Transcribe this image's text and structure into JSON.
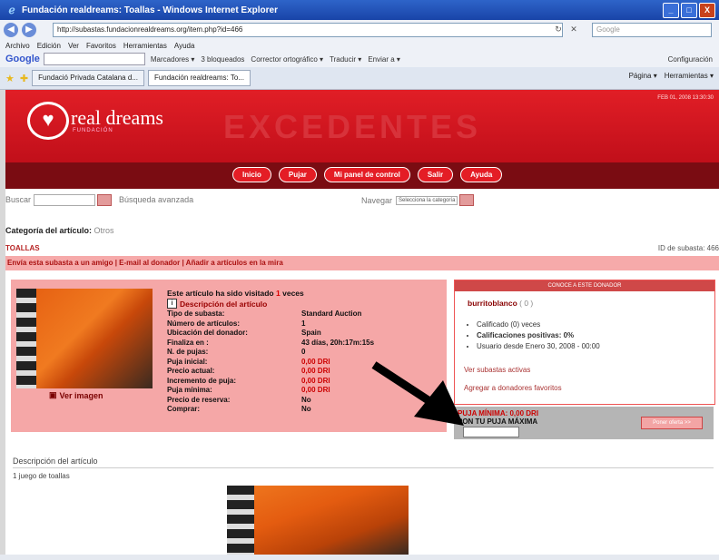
{
  "window": {
    "title": "Fundación realdreams: Toallas - Windows Internet Explorer",
    "minimize": "_",
    "maximize": "□",
    "close": "X"
  },
  "address": {
    "url": "http://subastas.fundacionrealdreams.org/item.php?id=466",
    "search_placeholder": "Google"
  },
  "menu": [
    "Archivo",
    "Edición",
    "Ver",
    "Favoritos",
    "Herramientas",
    "Ayuda"
  ],
  "google_toolbar": {
    "logo": "Google",
    "items": [
      "Marcadores ▾",
      "3 bloqueados",
      "Corrector ortográfico ▾",
      "Traducir ▾",
      "Enviar a ▾"
    ],
    "config": "Configuración"
  },
  "tabs": [
    {
      "label": "Fundació Privada Catalana d..."
    },
    {
      "label": "Fundación realdreams: To..."
    }
  ],
  "tab_tools": [
    "Página ▾",
    "Herramientas ▾"
  ],
  "site": {
    "logo": "real dreams",
    "logo_sub": "FUNDACIÓN",
    "banner": "EXCEDENTES",
    "date": "FEB 01, 2008 13:30:30",
    "nav": [
      "Inicio",
      "Pujar",
      "Mi panel de control",
      "Salir",
      "Ayuda"
    ]
  },
  "search": {
    "label": "Buscar",
    "advanced": "Búsqueda avanzada",
    "browse_label": "Navegar",
    "browse_value": "Selecciona la categoría"
  },
  "category": {
    "label": "Categoría del artículo:",
    "value": "Otros"
  },
  "item": {
    "title": "TOALLAS",
    "auction_id": "ID de subasta: 466",
    "actions": "Envía esta subasta a un amigo | E-mail al donador | Añadir a artículos en la mira",
    "visited_pre": "Este artículo ha sido visitado",
    "visited_count": "1",
    "visited_post": "veces",
    "desc_link": "Descripción del artículo",
    "view_image": "Ver imagen",
    "details": [
      {
        "k": "Tipo de subasta:",
        "v": "Standard Auction",
        "red": false
      },
      {
        "k": "Número de artículos:",
        "v": "1",
        "red": false
      },
      {
        "k": "Ubicación del donador:",
        "v": "Spain",
        "red": false
      },
      {
        "k": "Finaliza en :",
        "v": "43 días, 20h:17m:15s",
        "red": false
      },
      {
        "k": "N. de pujas:",
        "v": "0",
        "red": false
      },
      {
        "k": "Puja inicial:",
        "v": "0,00 DRI",
        "red": true
      },
      {
        "k": "Precio actual:",
        "v": "0,00 DRI",
        "red": true
      },
      {
        "k": "Incremento de puja:",
        "v": "0,00 DRI",
        "red": true
      },
      {
        "k": "Puja mínima:",
        "v": "0,00 DRI",
        "red": true
      },
      {
        "k": "Precio de reserva:",
        "v": "No",
        "red": false
      },
      {
        "k": "Comprar:",
        "v": "No",
        "red": false
      }
    ]
  },
  "donor": {
    "header": "CONOCE A ESTE DONADOR",
    "name": "burritoblanco",
    "score": "( 0 )",
    "facts": [
      "Calificado (0) veces",
      "Calificaciones positivas: 0%",
      "Usuario desde Enero 30, 2008 - 00:00"
    ],
    "link_auctions": "Ver subastas activas",
    "link_fav": "Agregar a donadores favoritos"
  },
  "bid": {
    "min_label": "PUJA MÍNIMA: 0,00 DRI",
    "prompt": "PON TU PUJA MÁXIMA",
    "button": "Poner oferta >>"
  },
  "description": {
    "title": "Descripción del artículo",
    "text": "1 juego de toallas"
  },
  "colors": {
    "brand_red": "#e11e26",
    "dark_red": "#7a0c12",
    "pink": "#f5a7a7"
  }
}
